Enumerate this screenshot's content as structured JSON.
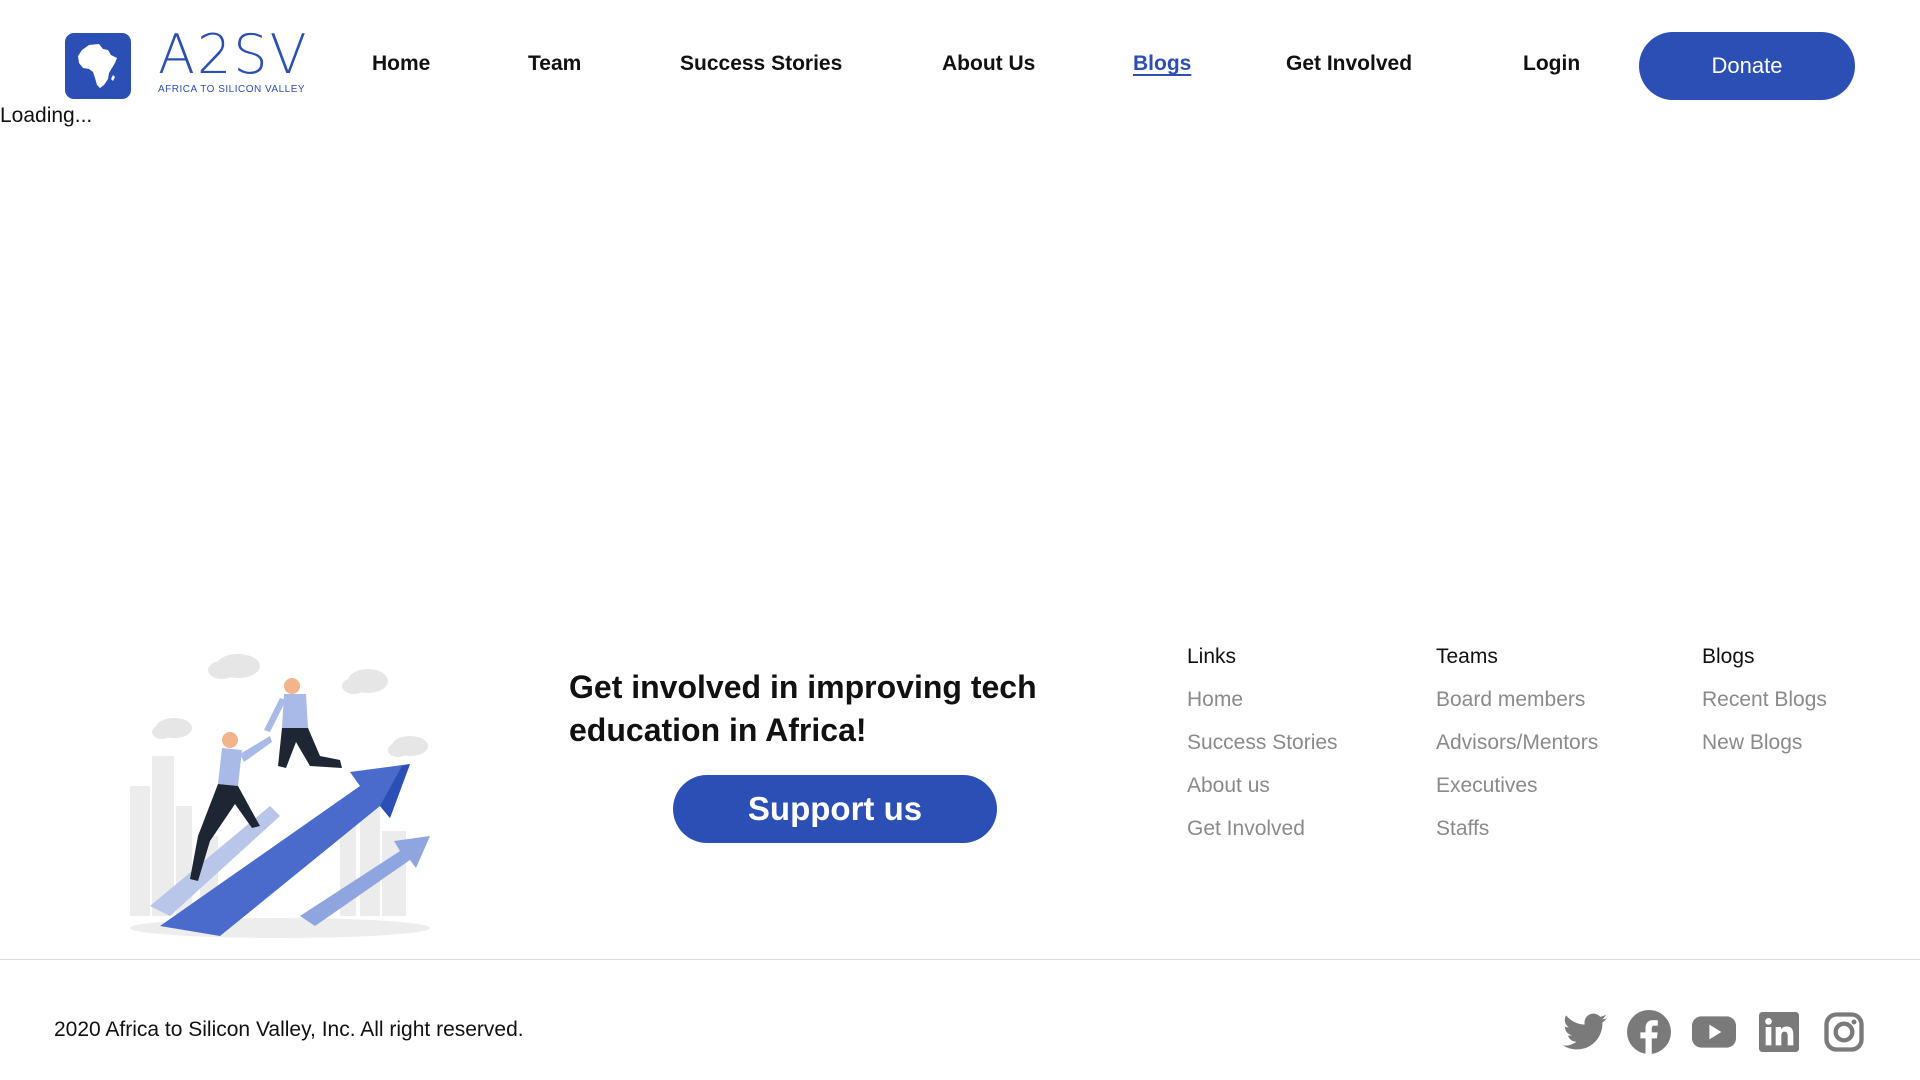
{
  "brand": {
    "wordmark": "A2SV",
    "tagline": "AFRICA TO SILICON VALLEY",
    "accent": "#2b4fb5"
  },
  "nav": {
    "items": [
      {
        "label": "Home"
      },
      {
        "label": "Team"
      },
      {
        "label": "Success Stories"
      },
      {
        "label": "About Us"
      },
      {
        "label": "Blogs",
        "active": true
      },
      {
        "label": "Get Involved"
      },
      {
        "label": "Login"
      }
    ],
    "donate_label": "Donate"
  },
  "status": {
    "loading_text": "Loading..."
  },
  "cta": {
    "heading": "Get involved in improving tech education in Africa!",
    "button_label": "Support us"
  },
  "footer": {
    "columns": [
      {
        "title": "Links",
        "items": [
          "Home",
          "Success Stories",
          "About us",
          "Get Involved"
        ]
      },
      {
        "title": "Teams",
        "items": [
          "Board members",
          "Advisors/Mentors",
          "Executives",
          "Staffs"
        ]
      },
      {
        "title": "Blogs",
        "items": [
          "Recent Blogs",
          "New Blogs"
        ]
      }
    ],
    "copyright": "2020 Africa to Silicon Valley, Inc. All right reserved.",
    "social_icons": [
      "twitter-icon",
      "facebook-icon",
      "youtube-icon",
      "linkedin-icon",
      "instagram-icon"
    ]
  }
}
